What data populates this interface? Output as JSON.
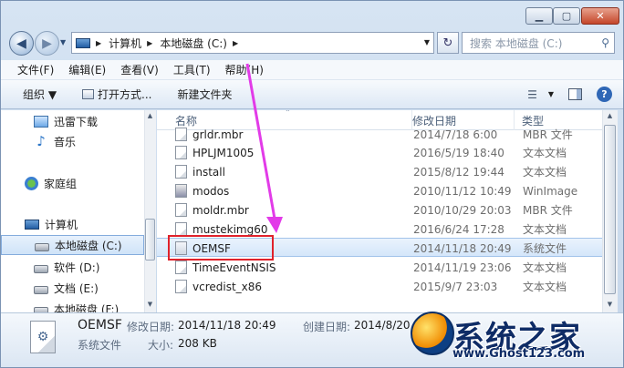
{
  "titlebar": {
    "min": "▁",
    "max": "▢",
    "close": "✕"
  },
  "nav": {
    "back": "◀",
    "forward": "▶",
    "history": "▼"
  },
  "address": {
    "segments": [
      "计算机",
      "本地磁盘 (C:)"
    ],
    "drop": "▼",
    "refresh": "↻",
    "search_placeholder": "搜索 本地磁盘 (C:)"
  },
  "menu": [
    "文件(F)",
    "编辑(E)",
    "查看(V)",
    "工具(T)",
    "帮助(H)"
  ],
  "toolbar": {
    "organize": "组织 ▼",
    "open_with": "打开方式...",
    "new_folder": "新建文件夹"
  },
  "sidebar": {
    "items": [
      {
        "label": "迅雷下载"
      },
      {
        "label": "音乐"
      },
      {
        "label": "家庭组"
      },
      {
        "label": "计算机"
      },
      {
        "label": "本地磁盘 (C:)"
      },
      {
        "label": "软件 (D:)"
      },
      {
        "label": "文档 (E:)"
      },
      {
        "label": "本地磁盘 (F:)"
      }
    ]
  },
  "columns": {
    "name": "名称",
    "date": "修改日期",
    "type": "类型"
  },
  "files": [
    {
      "name": "grldr.mbr",
      "date": "2014/7/18 6:00",
      "type": "MBR 文件"
    },
    {
      "name": "HPLJM1005",
      "date": "2016/5/19 18:40",
      "type": "文本文档"
    },
    {
      "name": "install",
      "date": "2015/8/12 19:44",
      "type": "文本文档"
    },
    {
      "name": "modos",
      "date": "2010/11/12 10:49",
      "type": "WinImage"
    },
    {
      "name": "moldr.mbr",
      "date": "2010/10/29 20:03",
      "type": "MBR 文件"
    },
    {
      "name": "mustekimg60",
      "date": "2016/6/24 17:28",
      "type": "文本文档"
    },
    {
      "name": "OEMSF",
      "date": "2014/11/18 20:49",
      "type": "系统文件"
    },
    {
      "name": "TimeEventNSIS",
      "date": "2014/11/19 23:06",
      "type": "文本文档"
    },
    {
      "name": "vcredist_x86",
      "date": "2015/9/7 23:03",
      "type": "文本文档"
    }
  ],
  "details": {
    "name": "OEMSF",
    "modified_label": "修改日期:",
    "modified": "2014/11/18 20:49",
    "created_label": "创建日期:",
    "created": "2014/8/20",
    "type": "系统文件",
    "size_label": "大小:",
    "size": "208 KB"
  },
  "watermark": {
    "title": "系统之家",
    "url": "www.Ghost123.com"
  },
  "colors": {
    "highlight_box": "#e0222b",
    "arrow": "#e23be8"
  }
}
